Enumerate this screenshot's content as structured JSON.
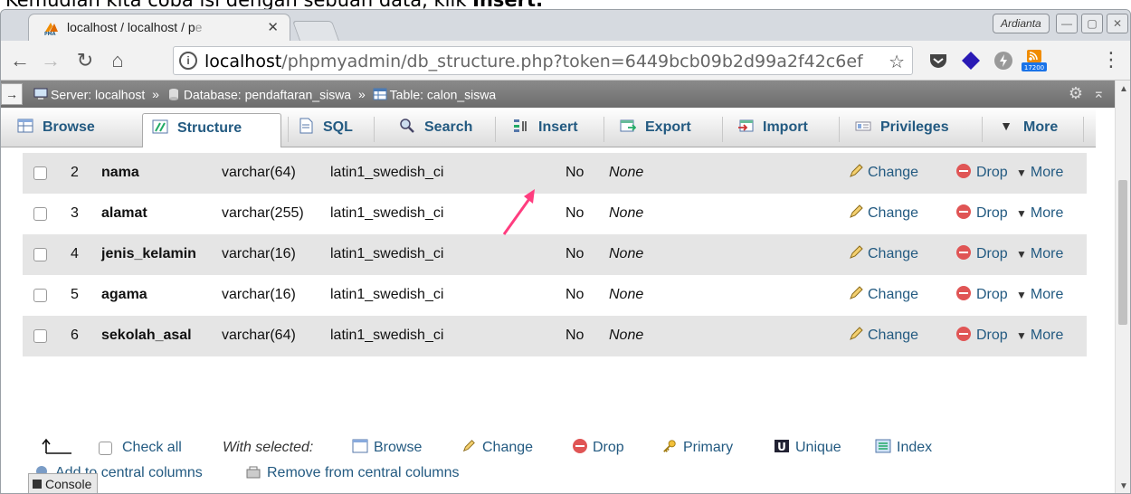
{
  "caption": {
    "prefix": "Kemudian kita coba isi dengan sebuah data, klik ",
    "bold": "Insert."
  },
  "browser": {
    "profile_name": "Ardianta",
    "tab_title_main": "localhost / localhost / p",
    "tab_title_fade": "e",
    "url_scheme_icon": "info-icon",
    "url_host": "localhost",
    "url_path": "/phpmyadmin/db_structure.php?token=6449bcb09b2d99a2f42c6ef",
    "rss_badge": "17200"
  },
  "breadcrumb": {
    "server_label": "Server: localhost",
    "database_label": "Database: pendaftaran_siswa",
    "table_label": "Table: calon_siswa",
    "separator": "»"
  },
  "tabs": [
    {
      "label": "Browse"
    },
    {
      "label": "Structure"
    },
    {
      "label": "SQL"
    },
    {
      "label": "Search"
    },
    {
      "label": "Insert"
    },
    {
      "label": "Export"
    },
    {
      "label": "Import"
    },
    {
      "label": "Privileges"
    },
    {
      "label": "More"
    }
  ],
  "columns": [
    {
      "num": "2",
      "name": "nama",
      "type": "varchar(64)",
      "collation": "latin1_swedish_ci",
      "null": "No",
      "default": "None"
    },
    {
      "num": "3",
      "name": "alamat",
      "type": "varchar(255)",
      "collation": "latin1_swedish_ci",
      "null": "No",
      "default": "None"
    },
    {
      "num": "4",
      "name": "jenis_kelamin",
      "type": "varchar(16)",
      "collation": "latin1_swedish_ci",
      "null": "No",
      "default": "None"
    },
    {
      "num": "5",
      "name": "agama",
      "type": "varchar(16)",
      "collation": "latin1_swedish_ci",
      "null": "No",
      "default": "None"
    },
    {
      "num": "6",
      "name": "sekolah_asal",
      "type": "varchar(64)",
      "collation": "latin1_swedish_ci",
      "null": "No",
      "default": "None"
    }
  ],
  "row_actions": {
    "change": "Change",
    "drop": "Drop",
    "more": "More"
  },
  "footer": {
    "check_all": "Check all",
    "with_selected": "With selected:",
    "browse": "Browse",
    "change": "Change",
    "drop": "Drop",
    "primary": "Primary",
    "unique": "Unique",
    "index": "Index",
    "add_central": "Add to central columns",
    "remove_central": "Remove from central columns"
  },
  "console_label": "Console",
  "colors": {
    "link": "#235a81",
    "annotation_arrow": "#ff3d7f",
    "breadcrumb_bg": "#7a7a7a"
  }
}
